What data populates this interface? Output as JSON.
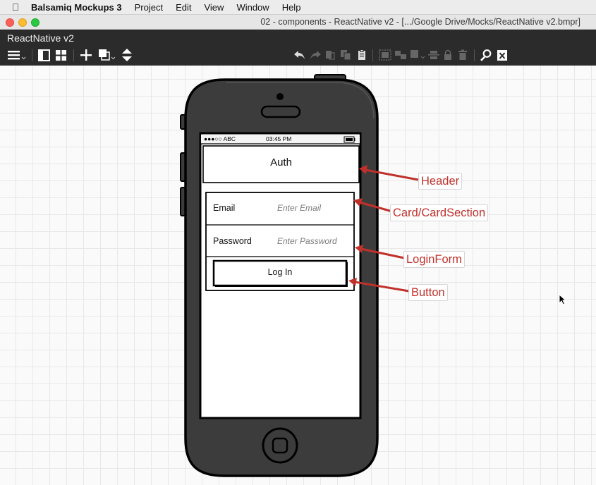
{
  "menubar": {
    "app_name": "Balsamiq Mockups 3",
    "items": [
      "Project",
      "Edit",
      "View",
      "Window",
      "Help"
    ]
  },
  "window": {
    "title": "02 - components - ReactNative v2 - [.../Google Drive/Mocks/ReactNative v2.bmpr]"
  },
  "app_header": {
    "project_name": "ReactNative v2"
  },
  "mockup": {
    "status_bar": {
      "carrier": "●●●○○ ABC",
      "time": "03:45 PM"
    },
    "header_title": "Auth",
    "email_label": "Email",
    "email_placeholder": "Enter Email",
    "password_label": "Password",
    "password_placeholder": "Enter Password",
    "login_button": "Log In"
  },
  "annotations": {
    "header": "Header",
    "card": "Card/CardSection",
    "login_form": "LoginForm",
    "button": "Button"
  },
  "colors": {
    "annotation": "#c0312b",
    "phone_body": "#3c3c3c",
    "app_header_bg": "#2b2b2b"
  }
}
